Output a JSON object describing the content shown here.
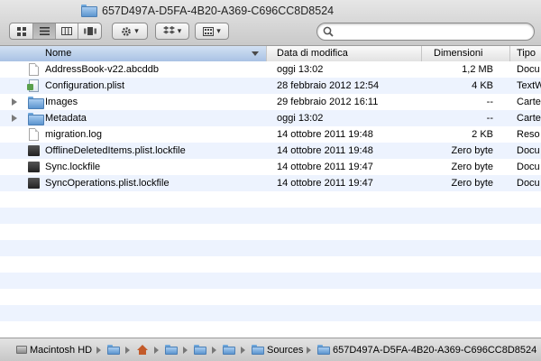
{
  "window": {
    "title": "657D497A-D5FA-4B20-A369-C696CC8D8524"
  },
  "toolbar": {
    "view_buttons": [
      {
        "icon": "icon-view-icon",
        "active": false
      },
      {
        "icon": "list-view-icon",
        "active": true
      },
      {
        "icon": "column-view-icon",
        "active": false
      },
      {
        "icon": "coverflow-view-icon",
        "active": false
      }
    ],
    "action_icon": "gear-icon",
    "share_icon": "dropbox-icon",
    "arrange_icon": "arrange-grid-icon",
    "search": {
      "value": "",
      "placeholder": ""
    }
  },
  "columns": {
    "name": "Nome",
    "date": "Data di modifica",
    "size": "Dimensioni",
    "kind": "Tipo"
  },
  "files": [
    {
      "name": "AddressBook-v22.abcddb",
      "date": "oggi 13:02",
      "size": "1,2 MB",
      "kind": "Docu",
      "icon": "document-icon",
      "folder": false
    },
    {
      "name": "Configuration.plist",
      "date": "28 febbraio 2012 12:54",
      "size": "4 KB",
      "kind": "TextW",
      "icon": "plist-icon",
      "folder": false
    },
    {
      "name": "Images",
      "date": "29 febbraio 2012 16:11",
      "size": "--",
      "kind": "Carte",
      "icon": "folder-icon",
      "folder": true
    },
    {
      "name": "Metadata",
      "date": "oggi 13:02",
      "size": "--",
      "kind": "Carte",
      "icon": "folder-icon",
      "folder": true
    },
    {
      "name": "migration.log",
      "date": "14 ottobre 2011 19:48",
      "size": "2 KB",
      "kind": "Reso",
      "icon": "document-icon",
      "folder": false
    },
    {
      "name": "OfflineDeletedItems.plist.lockfile",
      "date": "14 ottobre 2011 19:48",
      "size": "Zero byte",
      "kind": "Docu",
      "icon": "lockfile-icon",
      "folder": false
    },
    {
      "name": "Sync.lockfile",
      "date": "14 ottobre 2011 19:47",
      "size": "Zero byte",
      "kind": "Docu",
      "icon": "lockfile-icon",
      "folder": false
    },
    {
      "name": "SyncOperations.plist.lockfile",
      "date": "14 ottobre 2011 19:47",
      "size": "Zero byte",
      "kind": "Docu",
      "icon": "lockfile-icon",
      "folder": false
    }
  ],
  "pathbar": {
    "items": [
      {
        "label": "Macintosh HD",
        "icon": "hard-drive-icon"
      },
      {
        "label": "",
        "icon": "user-folder-icon"
      },
      {
        "label": "",
        "icon": "home-icon"
      },
      {
        "label": "",
        "icon": "library-folder-icon"
      },
      {
        "label": "",
        "icon": "folder-icon"
      },
      {
        "label": "",
        "icon": "folder-icon"
      },
      {
        "label": "",
        "icon": "folder-icon"
      },
      {
        "label": "Sources",
        "icon": "folder-icon"
      },
      {
        "label": "657D497A-D5FA-4B20-A369-C696CC8D8524",
        "icon": "folder-icon"
      }
    ]
  }
}
